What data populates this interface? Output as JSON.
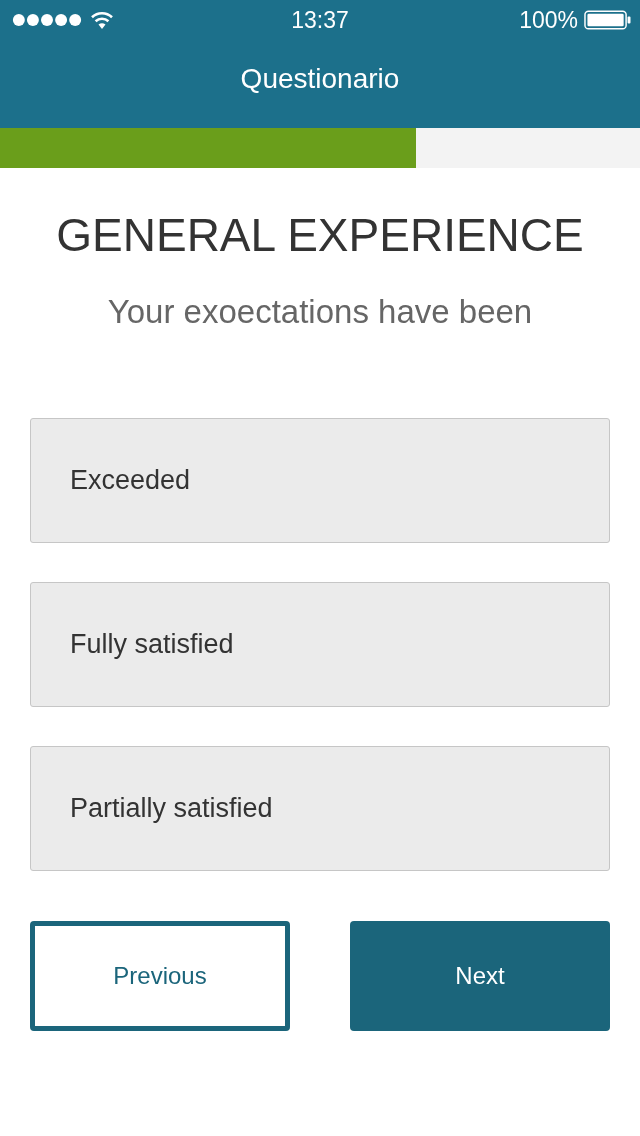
{
  "status_bar": {
    "time": "13:37",
    "battery": "100%"
  },
  "nav_bar": {
    "title": "Questionario"
  },
  "progress": {
    "level": 0.65
  },
  "question": {
    "heading": "GENERAL EXPERIENCE",
    "prompt": "Your exoectations have been"
  },
  "options": [
    {
      "label": "Exceeded",
      "selected": false
    },
    {
      "label": "Fully satisfied",
      "selected": false
    },
    {
      "label": "Partially satisfied",
      "selected": false
    }
  ],
  "buttons": [
    {
      "label": "Previous",
      "kind": "outline"
    },
    {
      "label": "Next",
      "kind": "filled"
    }
  ]
}
